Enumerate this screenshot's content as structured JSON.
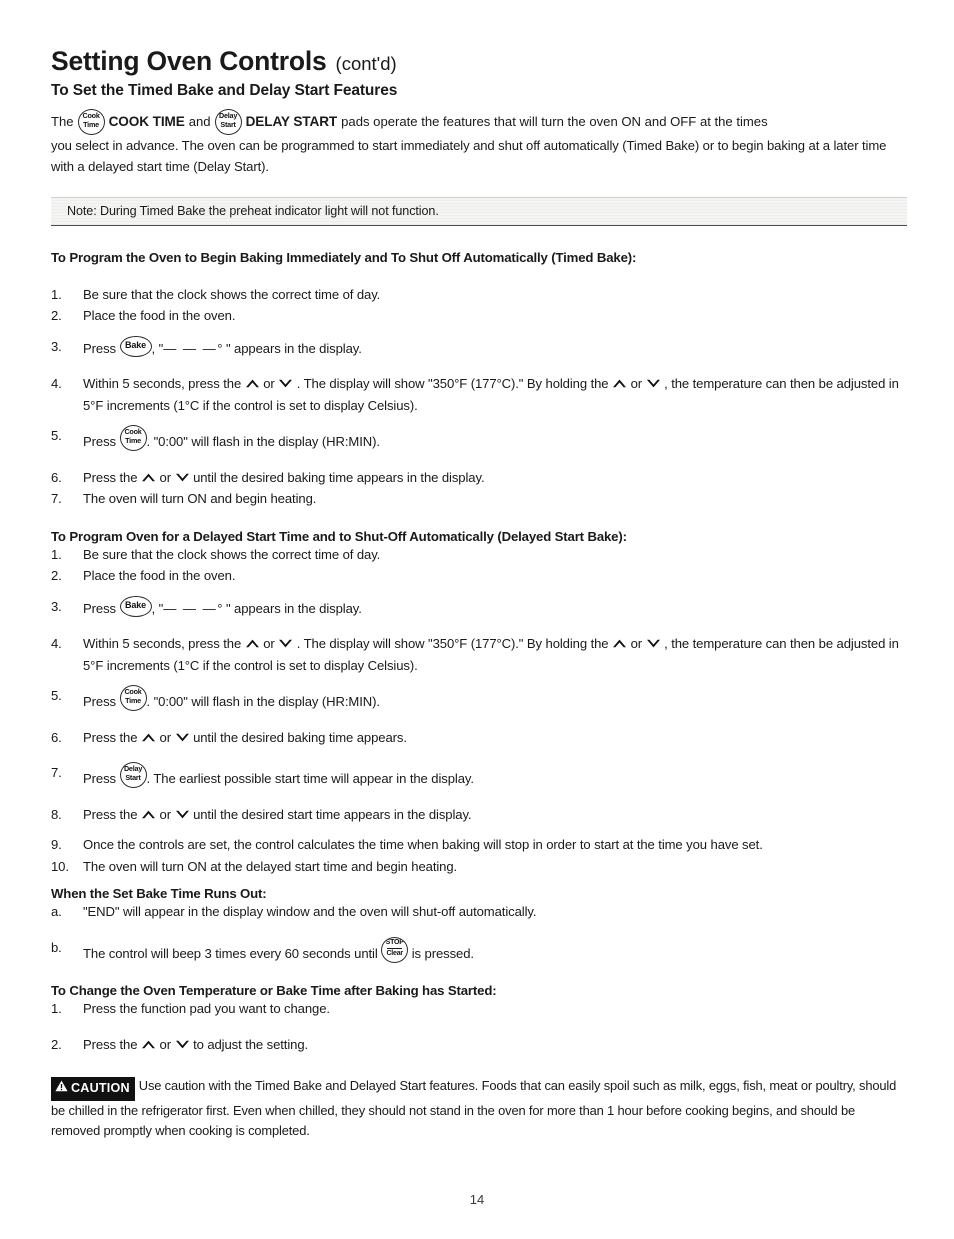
{
  "document": {
    "title_main": "Setting Oven Controls",
    "title_cont": "(cont'd)",
    "subtitle": "To Set the Timed Bake and Delay Start Features",
    "page_number": "14"
  },
  "intro": {
    "seg_the": "The",
    "pad_cook_time_line1": "Cook",
    "pad_cook_time_line2": "Time",
    "label_cook_time": "COOK TIME",
    "seg_and": "and",
    "pad_delay_start_line1": "Delay",
    "pad_delay_start_line2": "Start",
    "label_delay_start": "DELAY START",
    "seg_tail": "pads operate the features that will turn the oven ON and OFF at the times",
    "paragraph_rest": "you select in advance. The oven can be programmed to start immediately and shut off automatically (Timed Bake) or to begin baking at a later time with a delayed start time (Delay Start)."
  },
  "note": {
    "text": "Note: During Timed Bake the preheat indicator light will not function."
  },
  "section_timed_bake": {
    "heading": "To Program the Oven to Begin Baking Immediately and To Shut Off Automatically (Timed Bake):",
    "steps": [
      {
        "num": "1.",
        "text": "Be sure that the clock shows the correct time of day."
      },
      {
        "num": "2.",
        "text": "Place the food in the oven."
      },
      {
        "num": "3.",
        "pre": "Press",
        "pad": "Bake",
        "post_quote_open": "\"",
        "dashes": "— — —",
        "degree": "°",
        "post_quote_close": "\"",
        "post": "appears in the display."
      },
      {
        "num": "4.",
        "part1": "Within 5 seconds, press the",
        "sep": "or",
        "part2": ". The display will show \"350°F (177°C).\" By holding the",
        "sep2": "or",
        "part3": ", the temperature can then be adjusted in 5°F increments (1°C if the control is set to display Celsius)."
      },
      {
        "num": "5.",
        "pre": "Press",
        "pad_line1": "Cook",
        "pad_line2": "Time",
        "post": ". \"0:00\" will flash in the display (HR:MIN)."
      },
      {
        "num": "6.",
        "part1": "Press the",
        "sep": "or",
        "part2": "until the desired baking time appears in the display."
      },
      {
        "num": "7.",
        "text": "The oven will turn ON and begin heating."
      }
    ]
  },
  "section_delay_start": {
    "heading": "To Program Oven for a Delayed Start Time and to Shut-Off Automatically (Delayed Start Bake):",
    "steps": [
      {
        "num": "1.",
        "text": "Be sure that the clock shows the correct time of day."
      },
      {
        "num": "2.",
        "text": "Place the food in the oven."
      },
      {
        "num": "3.",
        "pre": "Press",
        "pad": "Bake",
        "post_quote_open": "\"",
        "dashes": "— — —",
        "degree": "°",
        "post_quote_close": "\"",
        "post": "appears in the display."
      },
      {
        "num": "4.",
        "part1": "Within 5 seconds, press the",
        "sep": "or",
        "part2": ". The display will show \"350°F (177°C).\" By holding the",
        "sep2": "or",
        "part3": ", the temperature can then be adjusted in 5°F increments (1°C if the control is set to display Celsius)."
      },
      {
        "num": "5.",
        "pre": "Press",
        "pad_line1": "Cook",
        "pad_line2": "Time",
        "post": ". \"0:00\" will flash in the display (HR:MIN)."
      },
      {
        "num": "6.",
        "part1": "Press the",
        "sep": "or",
        "part2": "until the desired baking time appears."
      },
      {
        "num": "7.",
        "pre": "Press",
        "pad_line1": "Delay",
        "pad_line2": "Start",
        "post": ". The earliest possible start time will appear in the display."
      },
      {
        "num": "8.",
        "part1": "Press the",
        "sep": "or",
        "part2": "until the desired start time appears in the display."
      },
      {
        "num": "9.",
        "text": "Once the controls are set, the control calculates the time when baking will stop in order to start at the time you have set."
      },
      {
        "num": "10.",
        "text": "The oven will turn ON at the delayed start time and begin heating."
      }
    ]
  },
  "section_runs_out": {
    "heading": "When the Set Bake Time Runs Out:",
    "steps": [
      {
        "num": "a.",
        "text": "\"END\" will appear in the display window and the oven will shut-off automatically."
      },
      {
        "num": "b.",
        "part1": "The control will beep 3 times every 60 seconds until",
        "pad_top": "STOP",
        "pad_bottom": "Clear",
        "part2": "is pressed."
      }
    ]
  },
  "section_change_temp": {
    "heading": "To Change the Oven Temperature or Bake Time after Baking has Started:",
    "steps": [
      {
        "num": "1.",
        "text": "Press the function pad you want to change."
      },
      {
        "num": "2.",
        "part1": "Press the",
        "sep": "or",
        "part2": "to adjust the setting."
      }
    ]
  },
  "caution": {
    "badge_label": "CAUTION",
    "text": "Use caution with the Timed Bake and Delayed Start features. Foods that can easily spoil such as milk, eggs, fish, meat or poultry, should be chilled in the refrigerator first. Even when chilled, they should not stand in the oven for more than 1 hour before cooking begins, and should be removed promptly when cooking is completed."
  },
  "colors": {
    "text": "#1a1a1a",
    "caution_badge_bg": "#111111",
    "note_bg": "#f4f4f3"
  }
}
